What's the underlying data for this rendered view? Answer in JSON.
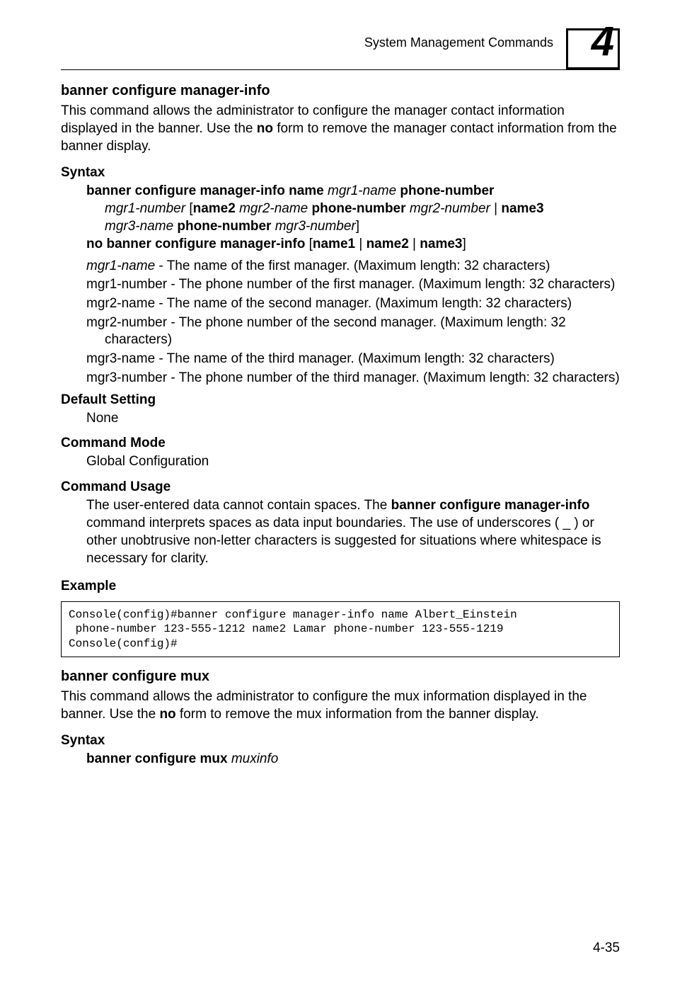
{
  "header": {
    "title": "System Management Commands",
    "chapter": "4"
  },
  "section1": {
    "title": "banner configure manager-info",
    "intro_parts": {
      "t1": "This command allows the administrator to configure the manager contact information displayed in the banner. Use the ",
      "no": "no",
      "t2": " form to remove the manager contact information from the banner display."
    },
    "syntax_label": "Syntax",
    "syntax": {
      "l1a": "banner configure manager-info name ",
      "l1b": "mgr1-name",
      "l1c": " phone-number",
      "l2a": "mgr1-number",
      "l2b": " [",
      "l2c": "name2",
      "l2d": " ",
      "l2e": "mgr2-name",
      "l2f": " phone-number ",
      "l2g": "mgr2-number",
      "l2h": " | ",
      "l2i": "name3",
      "l3a": "mgr3-name",
      "l3b": " phone-number ",
      "l3c": "mgr3-number",
      "l3d": "]",
      "l4a": "no banner configure manager-info",
      "l4b": " [",
      "l4c": "name1",
      "l4d": " | ",
      "l4e": "name2",
      "l4f": " | ",
      "l4g": "name3",
      "l4h": "]"
    },
    "params": {
      "p1a": "mgr1-name",
      "p1b": " - The name of the first manager. (Maximum length: 32 characters)",
      "p2": "mgr1-number - The phone number of the first manager. (Maximum length: 32 characters)",
      "p3": "mgr2-name - The name of the second manager. (Maximum length: 32 characters)",
      "p4": "mgr2-number - The phone number of the second manager. (Maximum length: 32 characters)",
      "p5": "mgr3-name - The name of the third manager. (Maximum length: 32 characters)",
      "p6": "mgr3-number - The phone number of the third manager. (Maximum length: 32 characters)"
    },
    "default_label": "Default Setting",
    "default_value": "None",
    "mode_label": "Command Mode",
    "mode_value": "Global Configuration",
    "usage_label": "Command Usage",
    "usage": {
      "t1": "The user-entered data cannot contain spaces. The ",
      "b1": "banner configure manager-info",
      "t2": " command interprets spaces as data input boundaries. The use of underscores ( _ ) or other unobtrusive non-letter characters is suggested for situations where whitespace is necessary for clarity."
    },
    "example_label": "Example",
    "example_code": "Console(config)#banner configure manager-info name Albert_Einstein \n phone-number 123-555-1212 name2 Lamar phone-number 123-555-1219\nConsole(config)#"
  },
  "section2": {
    "title": "banner configure mux",
    "intro_parts": {
      "t1": "This command allows the administrator to configure the mux information displayed in the banner. Use the ",
      "no": "no",
      "t2": " form to remove the mux information from the banner display."
    },
    "syntax_label": "Syntax",
    "syntax": {
      "a": "banner configure mux ",
      "b": "muxinfo"
    }
  },
  "footer": {
    "page": "4-35"
  }
}
